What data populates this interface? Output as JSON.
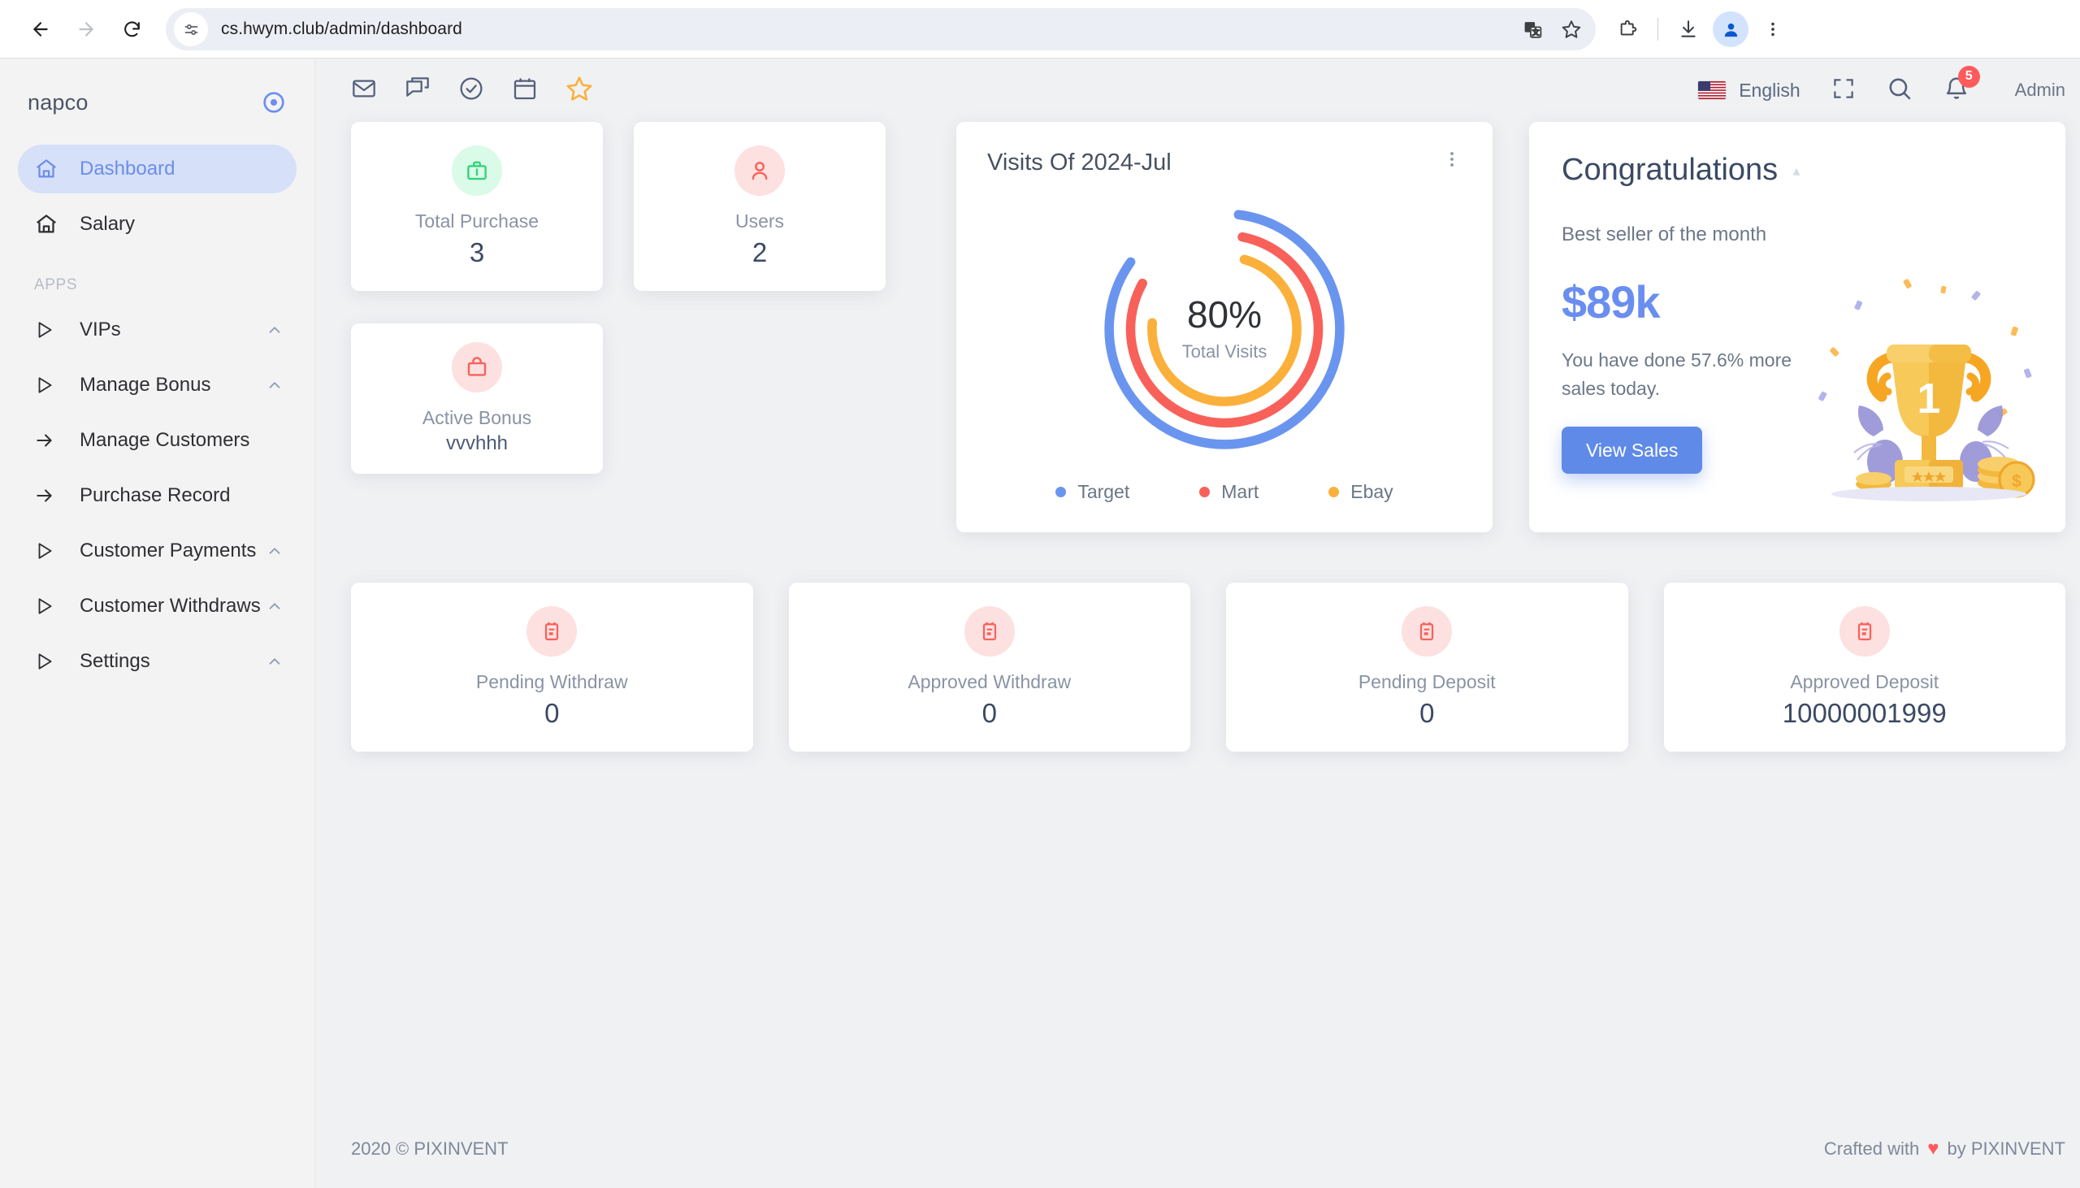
{
  "browser": {
    "url": "cs.hwym.club/admin/dashboard",
    "back_icon": "back-arrow-icon",
    "forward_icon": "forward-arrow-icon",
    "reload_icon": "reload-icon",
    "site_info_icon": "site-settings-icon",
    "translate_icon": "translate-icon",
    "bookmark_icon": "star-icon",
    "extensions_icon": "extensions-puzzle-icon",
    "download_icon": "download-icon",
    "profile_icon": "profile-avatar-icon",
    "menu_icon": "three-dot-menu-icon"
  },
  "sidebar": {
    "brand": "napco",
    "toggle_icon": "target-circle-icon",
    "section_label": "APPS",
    "items": [
      {
        "label": "Dashboard",
        "icon": "home-icon",
        "active": true,
        "chevron": false,
        "arrow": false
      },
      {
        "label": "Salary",
        "icon": "home-icon",
        "active": false,
        "chevron": false,
        "arrow": false
      },
      {
        "label": "VIPs",
        "icon": "play-triangle-icon",
        "active": false,
        "chevron": true,
        "arrow": false
      },
      {
        "label": "Manage Bonus",
        "icon": "play-triangle-icon",
        "active": false,
        "chevron": true,
        "arrow": false
      },
      {
        "label": "Manage Customers",
        "icon": "arrow-right-icon",
        "active": false,
        "chevron": false,
        "arrow": true
      },
      {
        "label": "Purchase Record",
        "icon": "arrow-right-icon",
        "active": false,
        "chevron": false,
        "arrow": true
      },
      {
        "label": "Customer Payments",
        "icon": "play-triangle-icon",
        "active": false,
        "chevron": true,
        "arrow": false
      },
      {
        "label": "Customer Withdraws",
        "icon": "play-triangle-icon",
        "active": false,
        "chevron": true,
        "arrow": false
      },
      {
        "label": "Settings",
        "icon": "play-triangle-icon",
        "active": false,
        "chevron": true,
        "arrow": false
      }
    ]
  },
  "appbar": {
    "icons": [
      "mail-icon",
      "chat-icon",
      "check-circle-icon",
      "calendar-icon",
      "star-icon"
    ],
    "language": "English",
    "flag_icon": "us-flag-icon",
    "fullscreen_icon": "fullscreen-icon",
    "search_icon": "search-icon",
    "bell_icon": "bell-icon",
    "notification_count": "5",
    "user_label": "Admin"
  },
  "stats": {
    "total_purchase": {
      "label": "Total Purchase",
      "value": "3",
      "icon": "briefcase-icon",
      "bubble": "#d9fbe7",
      "color": "#34d27b"
    },
    "users": {
      "label": "Users",
      "value": "2",
      "icon": "user-icon",
      "bubble": "#fde0e0",
      "color": "#f8615a"
    },
    "active_bonus": {
      "label": "Active Bonus",
      "value": "vvvhhh",
      "icon": "shopping-bag-icon",
      "bubble": "#fde0e0",
      "color": "#f8615a"
    }
  },
  "bottom_cards": [
    {
      "label": "Pending Withdraw",
      "value": "0",
      "icon": "calendar-note-icon"
    },
    {
      "label": "Approved Withdraw",
      "value": "0",
      "icon": "calendar-note-icon"
    },
    {
      "label": "Pending Deposit",
      "value": "0",
      "icon": "calendar-note-icon"
    },
    {
      "label": "Approved Deposit",
      "value": "10000001999",
      "icon": "calendar-note-icon"
    }
  ],
  "congrats": {
    "title": "Congratulations",
    "subtitle": "Best seller of the month",
    "amount": "$89k",
    "text": "You have done 57.6% more sales today.",
    "button": "View Sales",
    "accent": "#5f8ae8",
    "illustration": "trophy-illustration"
  },
  "footer": {
    "left": "2020 © PIXINVENT",
    "crafted_prefix": "Crafted with",
    "heart": "♥",
    "crafted_suffix": "by PIXINVENT"
  },
  "chart_data": {
    "type": "pie",
    "title": "Visits Of 2024-Jul",
    "center_value": "80%",
    "center_label": "Total Visits",
    "menu_icon": "kebab-menu-icon",
    "legend_position": "bottom",
    "series": [
      {
        "name": "Target",
        "value": 83,
        "color": "#6a95ef"
      },
      {
        "name": "Mart",
        "value": 80,
        "color": "#f8615a"
      },
      {
        "name": "Ebay",
        "value": 72,
        "color": "#fbb03b"
      }
    ],
    "categories": [
      "Target",
      "Mart",
      "Ebay"
    ],
    "values": [
      83,
      80,
      72
    ],
    "ylim": [
      0,
      100
    ],
    "xlabel": "",
    "ylabel": ""
  }
}
